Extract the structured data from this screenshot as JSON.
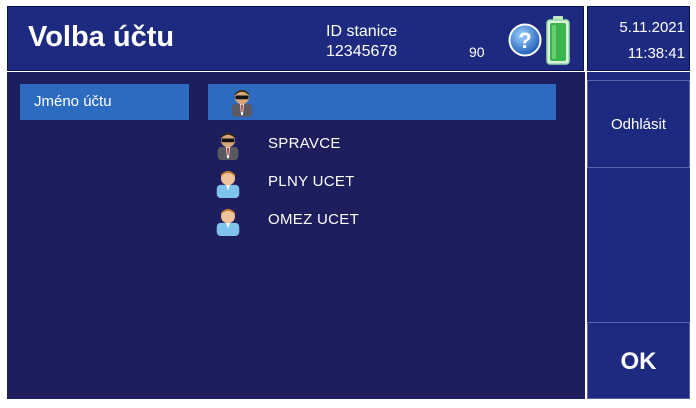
{
  "header": {
    "title": "Volba účtu",
    "station_label": "ID stanice",
    "station_id": "12345678",
    "battery_percent": "90",
    "help_icon": "help-icon",
    "battery_icon": "battery-icon"
  },
  "datetime": {
    "date": "5.11.2021",
    "time": "11:38:41"
  },
  "form": {
    "account_label": "Jméno účtu",
    "selected_icon": "admin-avatar-icon"
  },
  "accounts": [
    {
      "label": "SPRAVCE",
      "icon": "admin-avatar-icon"
    },
    {
      "label": "PLNY UCET",
      "icon": "user-avatar-icon"
    },
    {
      "label": "OMEZ UCET",
      "icon": "user-avatar-icon"
    }
  ],
  "buttons": {
    "logout": "Odhlásit",
    "ok": "OK"
  },
  "colors": {
    "panel": "#1d2a80",
    "main_background": "#1d1e5e",
    "accent_blue": "#2d6bc0",
    "battery_green": "#3bb54a"
  }
}
